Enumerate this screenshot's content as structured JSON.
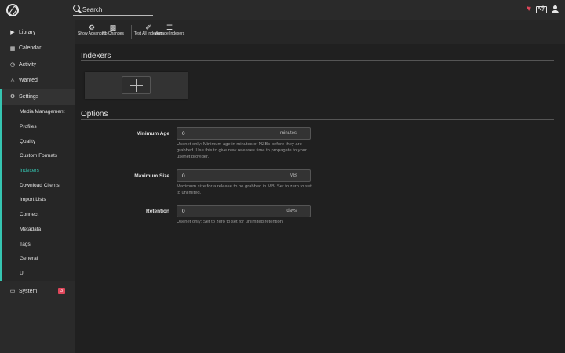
{
  "search": {
    "placeholder": "Search"
  },
  "sidebar": {
    "items": [
      {
        "label": "Library",
        "icon": "play-icon"
      },
      {
        "label": "Calendar",
        "icon": "calendar-icon"
      },
      {
        "label": "Activity",
        "icon": "clock-icon"
      },
      {
        "label": "Wanted",
        "icon": "warning-icon"
      },
      {
        "label": "Settings",
        "icon": "gear-icon"
      }
    ],
    "settings_sub": [
      "Media Management",
      "Profiles",
      "Quality",
      "Custom Formats",
      "Indexers",
      "Download Clients",
      "Import Lists",
      "Connect",
      "Metadata",
      "Tags",
      "General",
      "UI"
    ],
    "active_sub": "Indexers",
    "system": {
      "label": "System",
      "badge": "3",
      "icon": "laptop-icon"
    }
  },
  "toolbar": {
    "show_advanced": "Show Advanced",
    "no_changes": "No Changes",
    "test_all": "Test All Indexers",
    "manage": "Manage Indexers"
  },
  "main": {
    "indexers_title": "Indexers",
    "options_title": "Options",
    "fields": [
      {
        "label": "Minimum Age",
        "value": "0",
        "unit": "minutes",
        "help": "Usenet only: Minimum age in minutes of NZBs before they are grabbed. Use this to give new releases time to propagate to your usenet provider."
      },
      {
        "label": "Maximum Size",
        "value": "0",
        "unit": "MB",
        "help": "Maximum size for a release to be grabbed in MB. Set to zero to set to unlimited."
      },
      {
        "label": "Retention",
        "value": "0",
        "unit": "days",
        "help": "Usenet only: Set to zero to set for unlimited retention"
      }
    ]
  },
  "colors": {
    "accent": "#35c5b1",
    "badge": "#e0475b",
    "heart": "#e0475b"
  }
}
